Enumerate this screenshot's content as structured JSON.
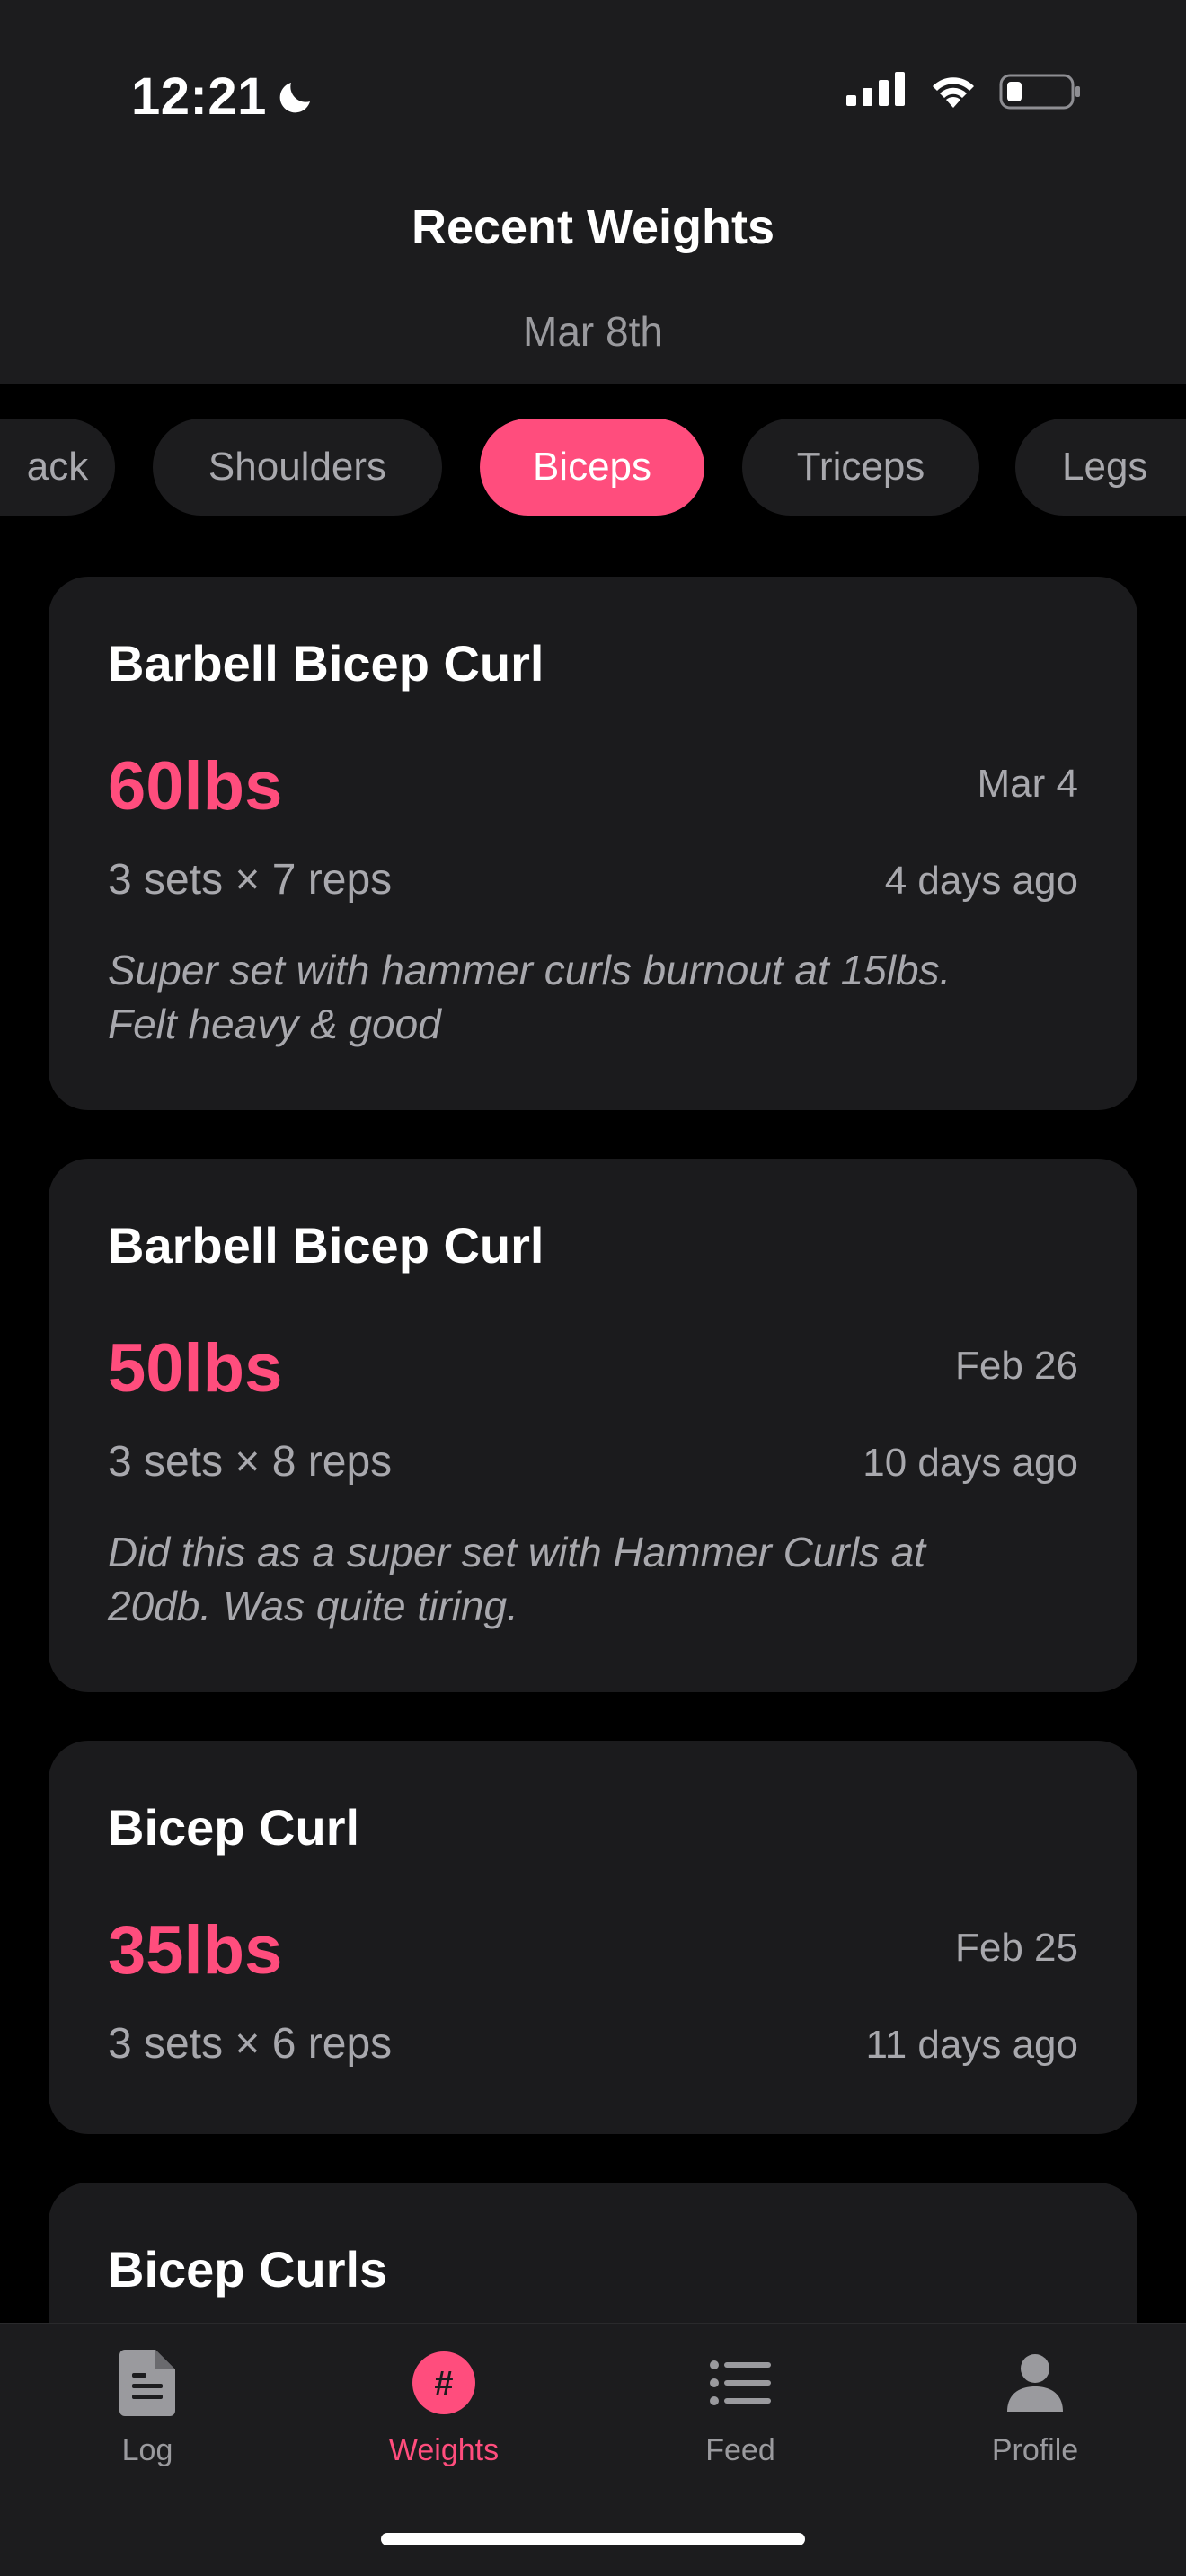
{
  "status_bar": {
    "time": "12:21"
  },
  "header": {
    "title": "Recent Weights",
    "date": "Mar 8th"
  },
  "chips": [
    {
      "label": "ack",
      "active": false
    },
    {
      "label": "Shoulders",
      "active": false
    },
    {
      "label": "Biceps",
      "active": true
    },
    {
      "label": "Triceps",
      "active": false
    },
    {
      "label": "Legs",
      "active": false
    }
  ],
  "cards": [
    {
      "exercise": "Barbell Bicep Curl",
      "weight": "60lbs",
      "date": "Mar 4",
      "sets": "3 sets × 7 reps",
      "ago": "4 days ago",
      "note_line1": "Super set with hammer curls burnout at 15lbs.",
      "note_line2": "Felt heavy & good"
    },
    {
      "exercise": "Barbell Bicep Curl",
      "weight": "50lbs",
      "date": "Feb 26",
      "sets": "3 sets × 8 reps",
      "ago": "10 days ago",
      "note_line1": "Did this as a super set with Hammer Curls at",
      "note_line2": "20db. Was quite tiring."
    },
    {
      "exercise": "Bicep Curl",
      "weight": "35lbs",
      "date": "Feb 25",
      "sets": "3 sets × 6 reps",
      "ago": "11 days ago"
    },
    {
      "exercise": "Bicep Curls"
    }
  ],
  "tabbar": {
    "items": [
      {
        "label": "Log",
        "icon": "document-icon",
        "active": false
      },
      {
        "label": "Weights",
        "icon": "hash-icon",
        "active": true
      },
      {
        "label": "Feed",
        "icon": "list-icon",
        "active": false
      },
      {
        "label": "Profile",
        "icon": "person-icon",
        "active": false
      }
    ]
  },
  "colors": {
    "accent": "#ff4d7d",
    "background": "#000000",
    "surface": "#1c1c1e",
    "card": "#1b1b1d",
    "secondary_text": "#a8a8ad"
  }
}
